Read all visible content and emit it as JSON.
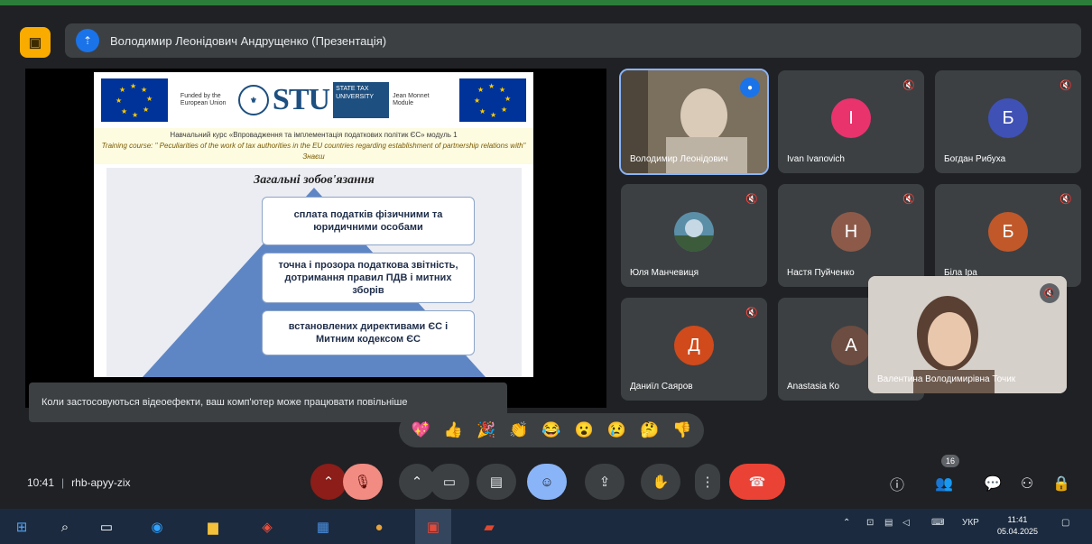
{
  "presenter_bar": {
    "app_icon": "meet-icon",
    "presenter_name": "Володимир Леонідович Андрущенко (Презентація)"
  },
  "slide": {
    "flag_label": "EU flag",
    "left_text": "Funded by the European Union",
    "logo_text": "STU",
    "logo_box_text": "STATE TAX UNIVERSITY",
    "right_text": "Jean Monnet Module",
    "course_line_1": "Навчальний курс «Впровадження та імплементація податкових політик ЄС» модуль 1",
    "course_line_2": "Training course: \" Peculiarities of the work of tax authorities in the EU countries regarding establishment of partnership relations with\" Знаєш",
    "title": "Загальні зобов'язання",
    "box_1": "сплата податків фізичними та юридичними особами",
    "box_2": "точна і прозора податкова звітність, дотримання правил ПДВ і митних зборів",
    "box_3": "встановлених директивами ЄС і Митним кодексом ЄС"
  },
  "caption": "Коли застосовуються відеоефекти, ваш комп'ютер може працювати повільніше",
  "participants": [
    {
      "name": "Володимир Леонідович",
      "initial": "",
      "color": "#6b6458"
    },
    {
      "name": "Ivan Ivanovich",
      "initial": "I",
      "color": "#e8336d"
    },
    {
      "name": "Богдан Рибуха",
      "initial": "Б",
      "color": "#3f51b5"
    },
    {
      "name": "Юля Манчевиця",
      "initial": "",
      "color": "#5b8fa8"
    },
    {
      "name": "Настя Пуйченко",
      "initial": "Н",
      "color": "#8d5a4a"
    },
    {
      "name": "Біла Іра",
      "initial": "Б",
      "color": "#c0582a"
    },
    {
      "name": "Даниїл Саяров",
      "initial": "Д",
      "color": "#d04a1c"
    },
    {
      "name": "Anastasia Ко",
      "initial": "А",
      "color": "#6d4c41"
    }
  ],
  "self_view": {
    "name": "Валентина Володимирівна Точик"
  },
  "reactions": [
    "💖",
    "👍",
    "🎉",
    "👏",
    "😂",
    "😮",
    "😢",
    "🤔",
    "👎"
  ],
  "meeting": {
    "time": "10:41",
    "code": "rhb-apyy-zix"
  },
  "controls": {
    "captions_icon": "arrow-up-icon",
    "mic_icon": "mic-off-icon",
    "cam_options_icon": "chevron-icon",
    "camera_icon": "camera-icon",
    "cc_icon": "captions-icon",
    "emoji_icon": "emoji-icon",
    "present_icon": "present-icon",
    "hand_icon": "hand-icon",
    "more_icon": "more-icon",
    "leave_icon": "hang-up-icon"
  },
  "right_controls": {
    "participants_count": "16"
  },
  "taskbar": {
    "lang": "УКР",
    "time": "11:41",
    "date": "05.04.2025"
  }
}
